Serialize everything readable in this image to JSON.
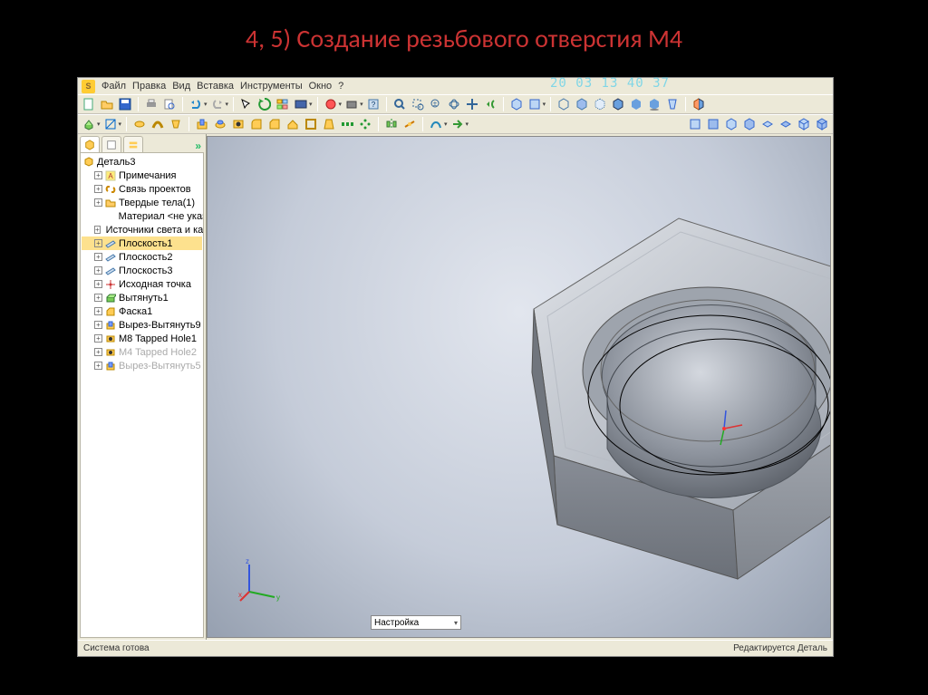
{
  "slide": {
    "title": "4, 5) Создание резьбового отверстия M4"
  },
  "menu": {
    "file": "Файл",
    "edit": "Правка",
    "view": "Вид",
    "insert": "Вставка",
    "tools": "Инструменты",
    "window": "Окно",
    "help": "?"
  },
  "timestamp": "20 03 13 40 37",
  "tree": {
    "root": "Деталь3",
    "items": [
      {
        "label": "Примечания",
        "icon": "a"
      },
      {
        "label": "Связь проектов",
        "icon": "link"
      },
      {
        "label": "Твердые тела(1)",
        "icon": "folder"
      },
      {
        "label": "Материал <не указан>",
        "icon": "mat",
        "indent": 2
      },
      {
        "label": "Источники света и камеры",
        "icon": "light"
      },
      {
        "label": "Плоскость1",
        "icon": "plane",
        "sel": true
      },
      {
        "label": "Плоскость2",
        "icon": "plane"
      },
      {
        "label": "Плоскость3",
        "icon": "plane"
      },
      {
        "label": "Исходная точка",
        "icon": "origin"
      },
      {
        "label": "Вытянуть1",
        "icon": "ext"
      },
      {
        "label": "Фаска1",
        "icon": "chamf"
      },
      {
        "label": "Вырез-Вытянуть9",
        "icon": "cut"
      },
      {
        "label": "M8 Tapped Hole1",
        "icon": "hole"
      },
      {
        "label": "M4 Tapped Hole2",
        "icon": "hole",
        "dim": true
      },
      {
        "label": "Вырез-Вытянуть5",
        "icon": "cut",
        "dim": true
      }
    ]
  },
  "viewport": {
    "bottom_select": "Настройка"
  },
  "status": {
    "left": "Система готова",
    "right": "Редактируется Деталь"
  }
}
